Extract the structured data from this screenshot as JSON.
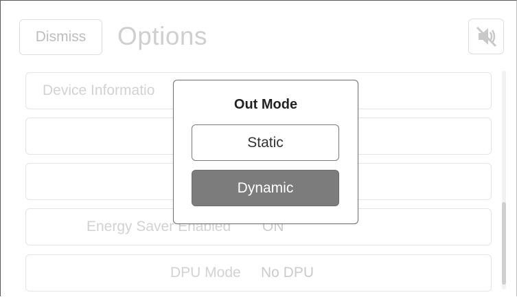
{
  "header": {
    "dismiss_label": "Dismiss",
    "title": "Options",
    "speaker_icon": "speaker-muted-icon"
  },
  "list": {
    "items": [
      {
        "label": "Device Informatio",
        "value": ""
      },
      {
        "label": "",
        "value": ""
      },
      {
        "label": "",
        "value": ""
      },
      {
        "label": "Energy Saver Enabled",
        "value": "ON"
      },
      {
        "label": "DPU Mode",
        "value": "No DPU"
      }
    ]
  },
  "modal": {
    "title": "Out Mode",
    "options": [
      {
        "label": "Static",
        "selected": false
      },
      {
        "label": "Dynamic",
        "selected": true
      }
    ]
  },
  "colors": {
    "selected_fill": "#7c7c7c",
    "border": "#6e6e6e"
  }
}
